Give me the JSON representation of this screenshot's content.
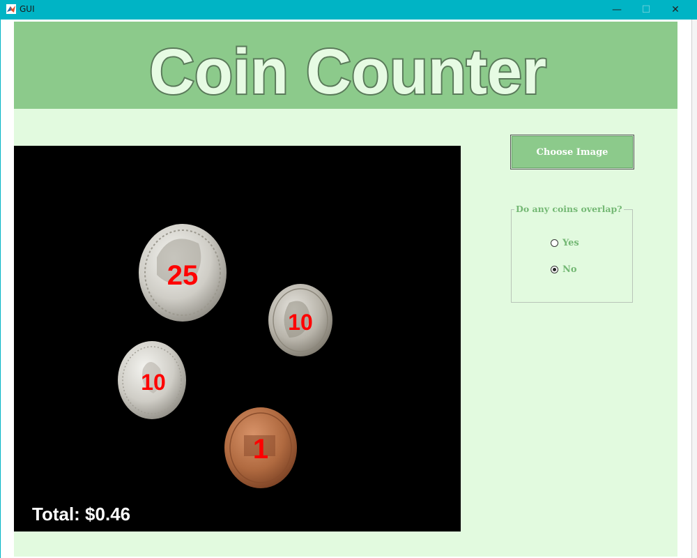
{
  "window": {
    "title": "GUI",
    "minimize_glyph": "—",
    "maximize_glyph": "☐",
    "close_glyph": "✕"
  },
  "header": {
    "title": "Coin Counter"
  },
  "controls": {
    "choose_image_label": "Choose Image"
  },
  "overlap": {
    "question": "Do any coins overlap?",
    "options": [
      {
        "label": "Yes",
        "selected": false
      },
      {
        "label": "No",
        "selected": true
      }
    ]
  },
  "image": {
    "coins": [
      {
        "value": "25",
        "type": "quarter"
      },
      {
        "value": "10",
        "type": "dime"
      },
      {
        "value": "10",
        "type": "dime"
      },
      {
        "value": "1",
        "type": "penny"
      }
    ],
    "total_text": "Total: $0.46"
  },
  "colors": {
    "titlebar": "#00b4c5",
    "header_green": "#8cca8b",
    "panel_bg": "#e2fadf",
    "label_green": "#74b874",
    "coin_label_red": "#ff0000"
  }
}
